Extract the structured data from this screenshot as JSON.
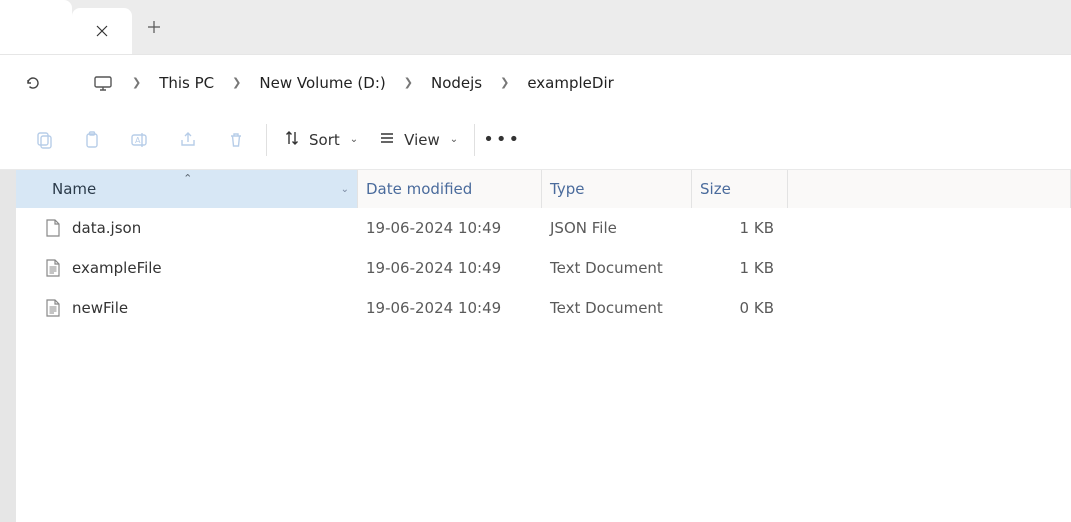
{
  "breadcrumb": [
    {
      "label": "This PC"
    },
    {
      "label": "New Volume (D:)"
    },
    {
      "label": "Nodejs"
    },
    {
      "label": "exampleDir"
    }
  ],
  "toolbar": {
    "sort_label": "Sort",
    "view_label": "View"
  },
  "columns": {
    "name": "Name",
    "date": "Date modified",
    "type": "Type",
    "size": "Size"
  },
  "rows": [
    {
      "icon": "file-page",
      "name": "data.json",
      "date": "19-06-2024 10:49",
      "type": "JSON File",
      "size": "1 KB"
    },
    {
      "icon": "file-text",
      "name": "exampleFile",
      "date": "19-06-2024 10:49",
      "type": "Text Document",
      "size": "1 KB"
    },
    {
      "icon": "file-text",
      "name": "newFile",
      "date": "19-06-2024 10:49",
      "type": "Text Document",
      "size": "0 KB"
    }
  ],
  "icons": {
    "file-page": "page",
    "file-text": "text"
  }
}
